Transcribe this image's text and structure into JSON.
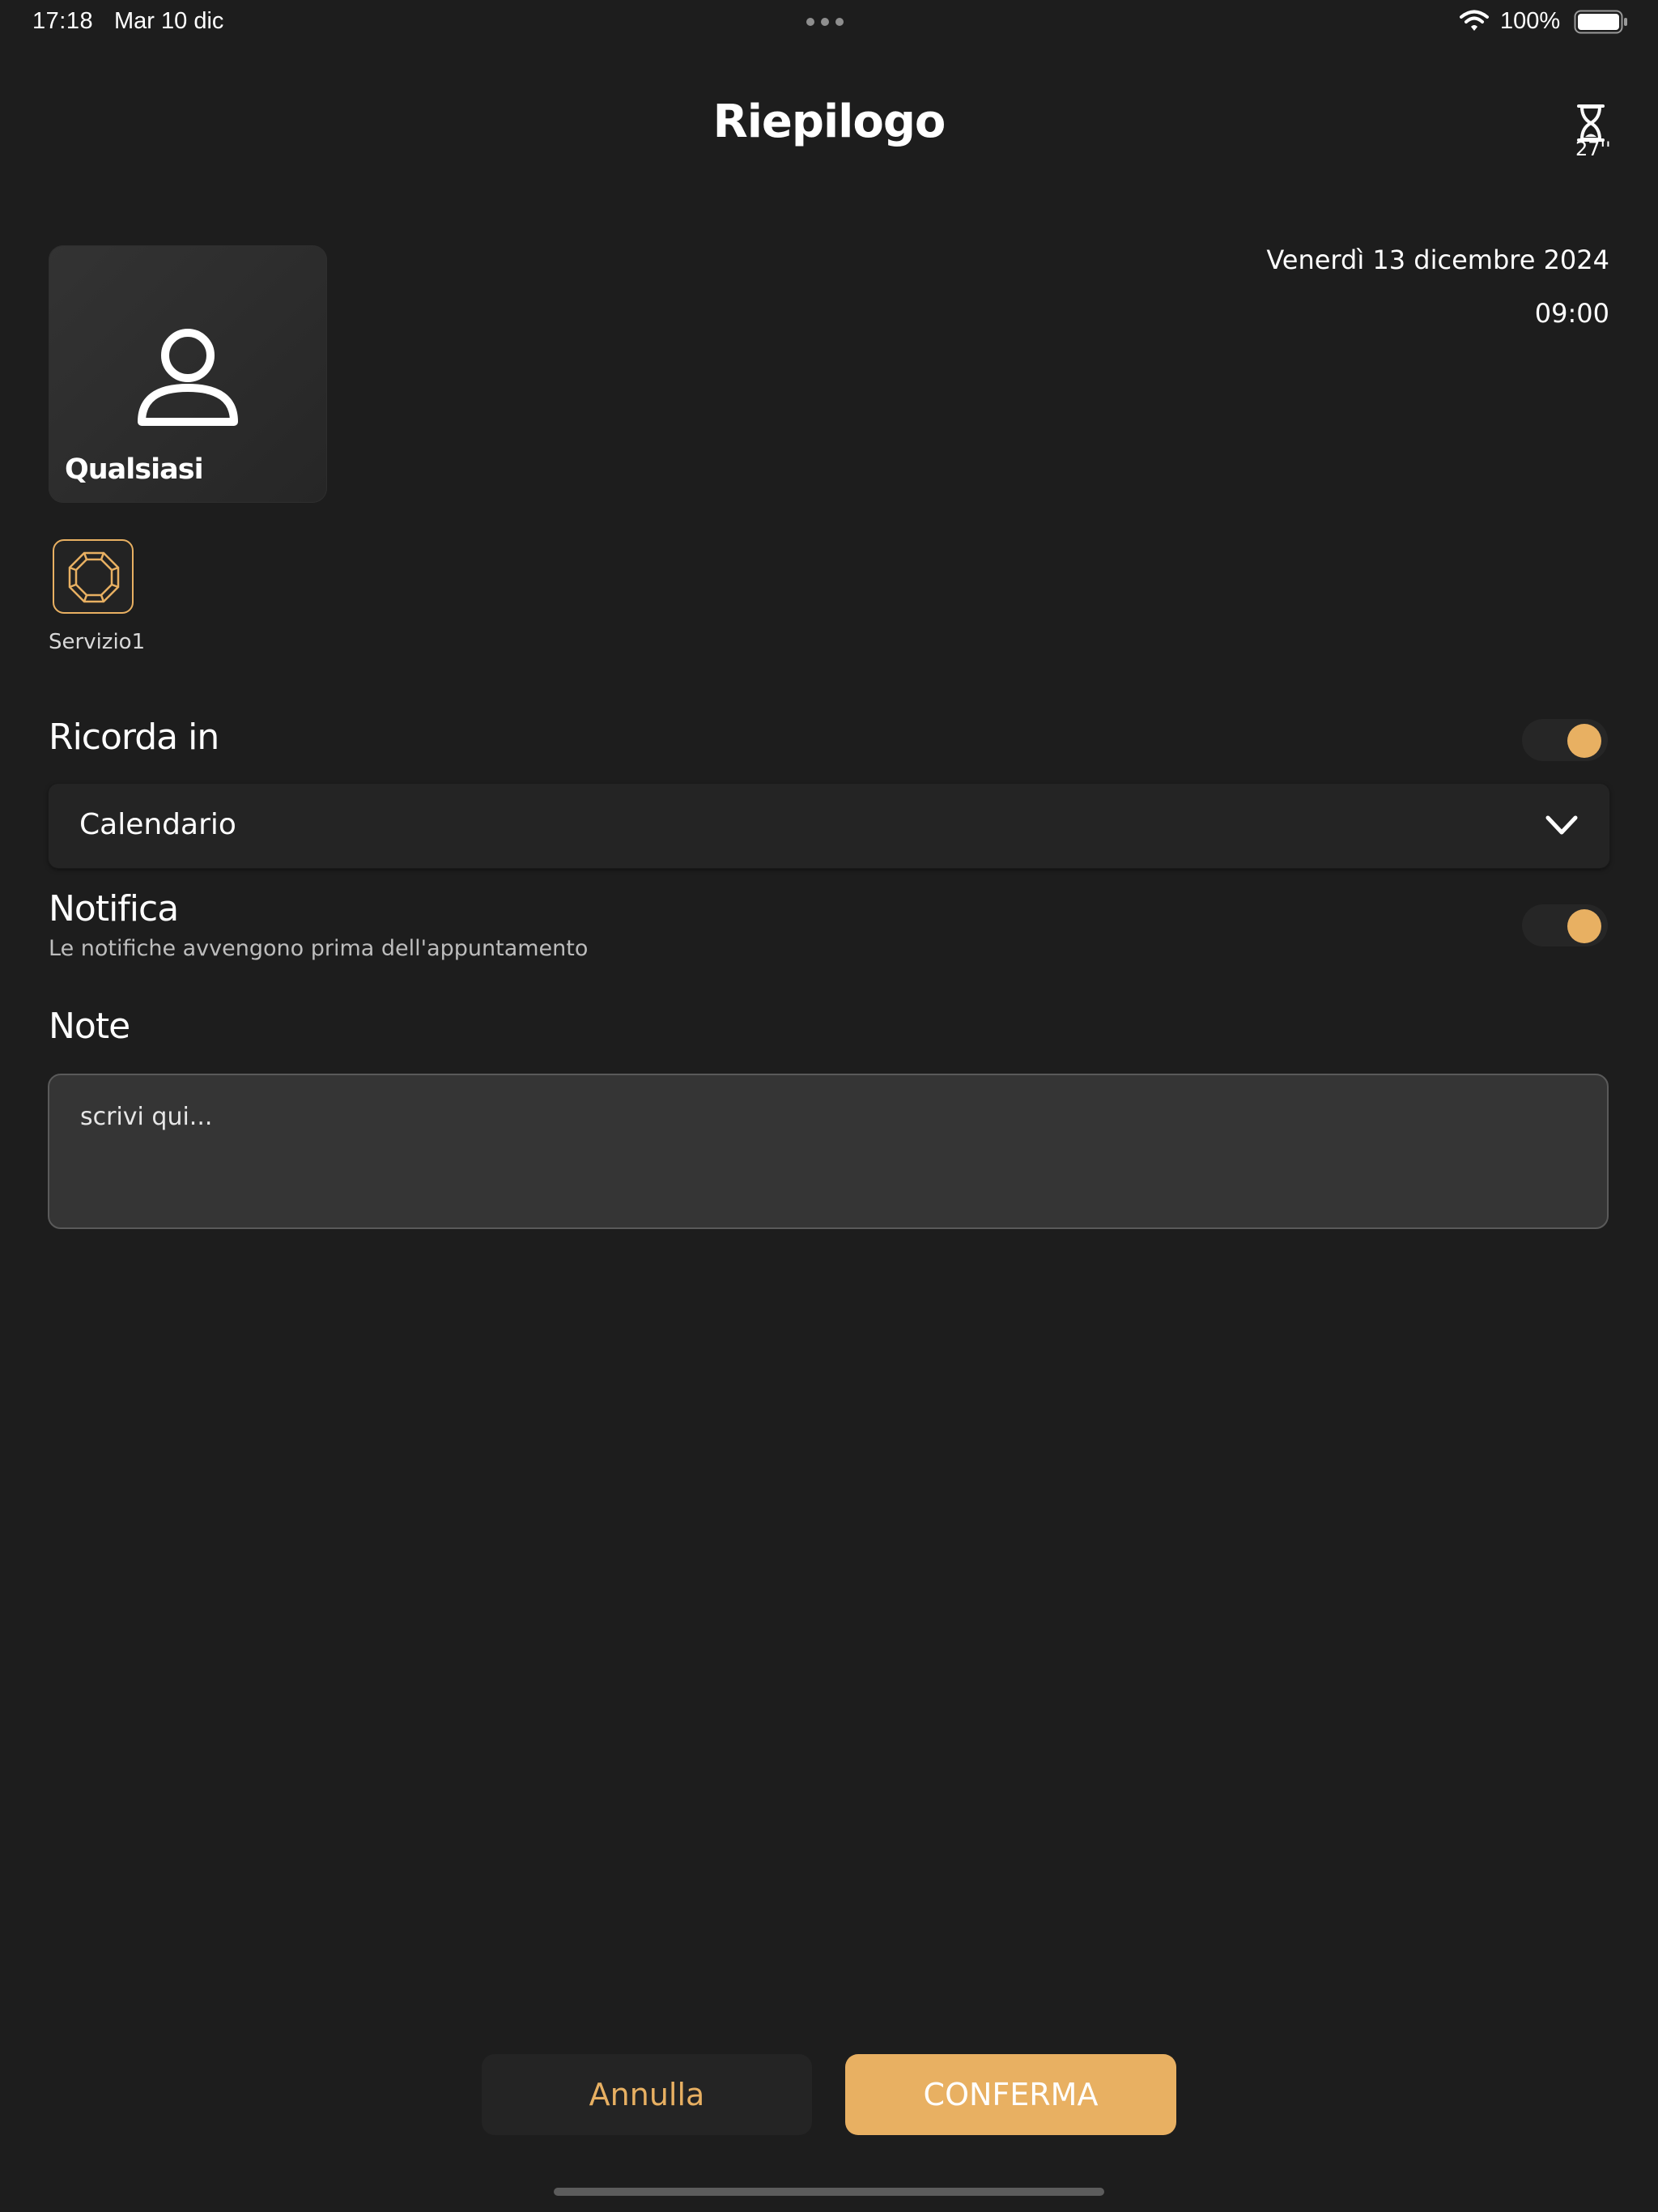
{
  "status_bar": {
    "time": "17:18",
    "date": "Mar 10 dic",
    "battery": "100%"
  },
  "header": {
    "title": "Riepilogo",
    "timer_label": "27''",
    "timer_icon": "hourglass-icon"
  },
  "operator": {
    "name": "Qualsiasi",
    "icon": "user-icon"
  },
  "appointment": {
    "date": "Venerdì 13 dicembre 2024",
    "time": "09:00"
  },
  "service": {
    "label": "Servizio1",
    "icon": "gem-icon"
  },
  "reminder": {
    "label": "Ricorda in",
    "enabled": true,
    "selected": "Calendario"
  },
  "notification": {
    "label": "Notifica",
    "subtitle": "Le notifiche avvengono prima dell'appuntamento",
    "enabled": true
  },
  "notes": {
    "label": "Note",
    "placeholder": "scrivi qui..."
  },
  "actions": {
    "cancel_label": "Annulla",
    "confirm_label": "CONFERMA"
  },
  "colors": {
    "background": "#1d1d1d",
    "accent": "#e8b062"
  }
}
